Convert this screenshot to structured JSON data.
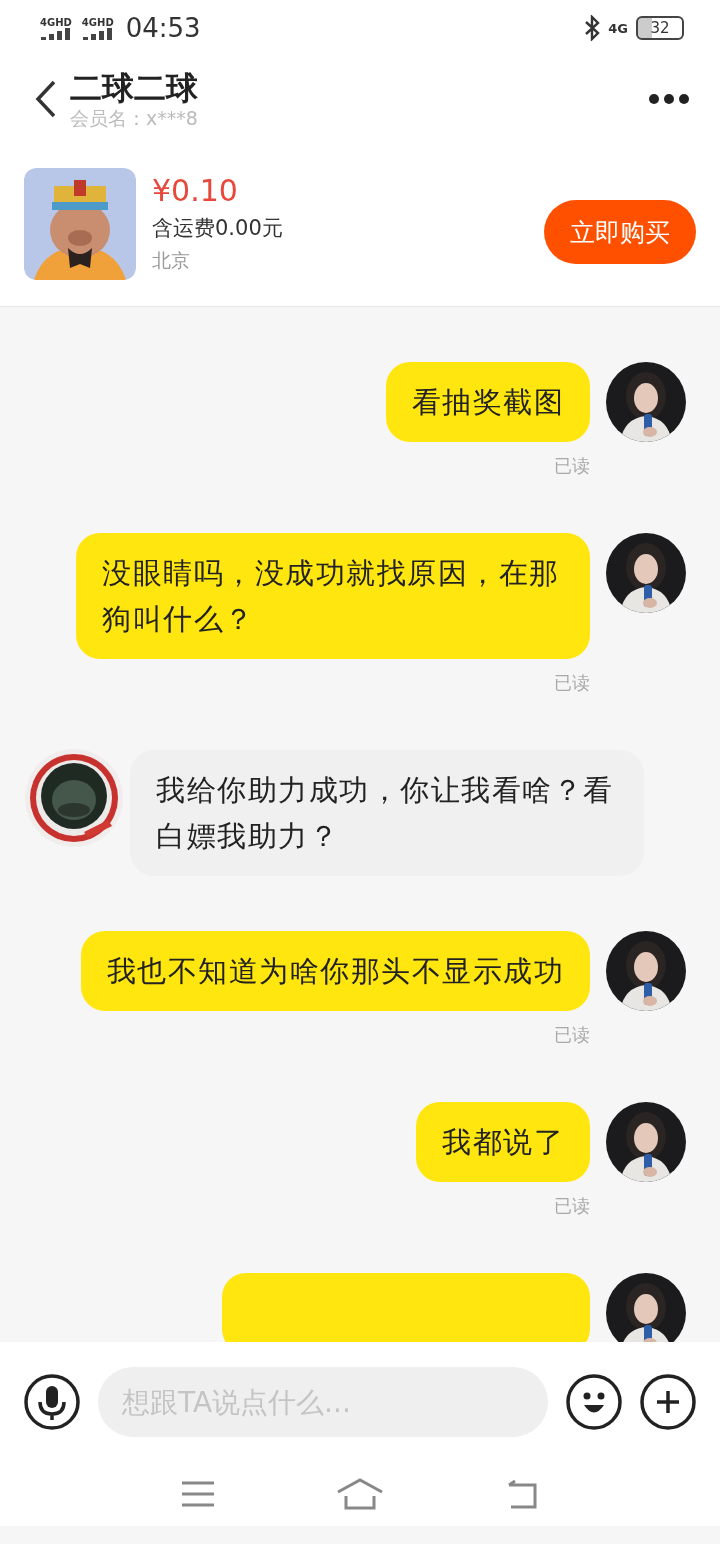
{
  "status_bar": {
    "networks": [
      "4GHD",
      "4GHD"
    ],
    "time": "04:53",
    "network_right": "4G",
    "battery": "32"
  },
  "header": {
    "title": "二球二球",
    "subtitle": "会员名：x***8"
  },
  "product": {
    "price": "¥0.10",
    "shipping": "含运费0.00元",
    "location": "北京",
    "buy_button": "立即购买"
  },
  "messages": [
    {
      "kind": "outgoing",
      "text": "看抽奖截图",
      "status": "已读"
    },
    {
      "kind": "outgoing",
      "text": "没眼睛吗，没成功就找原因，在那狗叫什么？",
      "status": "已读"
    },
    {
      "kind": "incoming",
      "text": "我给你助力成功，你让我看啥？看白嫖我助力？"
    },
    {
      "kind": "outgoing",
      "text": "我也不知道为啥你那头不显示成功",
      "status": "已读"
    },
    {
      "kind": "outgoing",
      "text": "我都说了",
      "status": "已读"
    },
    {
      "kind": "outgoing_cut"
    }
  ],
  "composer": {
    "placeholder": "想跟TA说点什么..."
  }
}
